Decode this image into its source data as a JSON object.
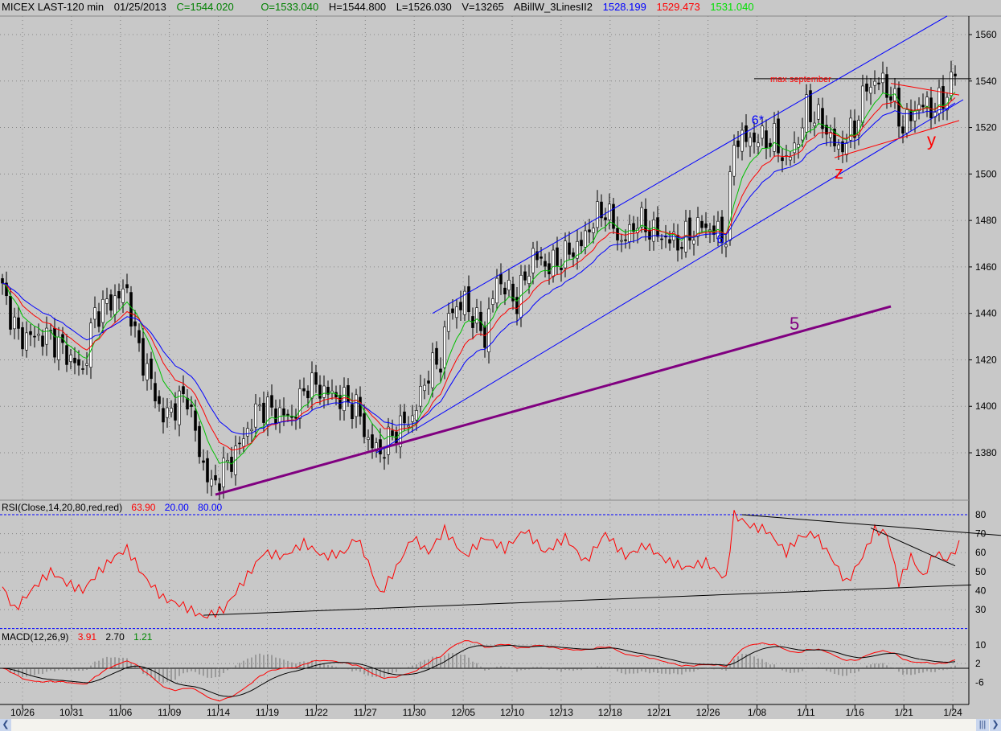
{
  "header": {
    "symbol": "MICEX LAST-120 min",
    "date": "01/25/2013",
    "close": "C=1544.020",
    "open": "O=1533.040",
    "high": "H=1544.800",
    "low": "L=1526.030",
    "volume": "V=13265",
    "indicator": "ABillW_3LinesII2",
    "ma1": "1528.199",
    "ma2": "1529.473",
    "ma3": "1531.040"
  },
  "rsi_label": {
    "name": "RSI(Close,14,20,80,red,red)",
    "value": "63.90",
    "low": "20.00",
    "high": "80.00"
  },
  "macd_label": {
    "name": "MACD(12,26,9)",
    "macd": "3.91",
    "signal": "2.70",
    "hist": "1.21"
  },
  "colors": {
    "blue": "#0000ff",
    "red": "#ff0000",
    "green": "#00c000",
    "purple": "#800080"
  },
  "chart_data": {
    "type": "candlestick",
    "price_axis": {
      "ticks": [
        "1560",
        "1540",
        "1520",
        "1500",
        "1480",
        "1460",
        "1440",
        "1420",
        "1400",
        "1380"
      ],
      "range": [
        1352,
        1568
      ]
    },
    "rsi_axis": {
      "ticks": [
        "80",
        "70",
        "60",
        "50",
        "40",
        "30"
      ],
      "range": [
        18,
        83
      ],
      "levels": [
        20,
        80
      ]
    },
    "macd_axis": {
      "ticks": [
        "10",
        "2",
        "-6"
      ],
      "range": [
        -11,
        13
      ]
    },
    "x_ticks": [
      "10/26",
      "10/31",
      "11/06",
      "11/09",
      "11/14",
      "11/19",
      "11/22",
      "11/27",
      "11/30",
      "12/05",
      "12/10",
      "12/13",
      "12/18",
      "12/21",
      "12/26",
      "1/08",
      "1/11",
      "1/16",
      "1/21",
      "1/24"
    ],
    "close_anchors": [
      [
        0,
        1450
      ],
      [
        4,
        1430
      ],
      [
        12,
        1430
      ],
      [
        20,
        1415
      ],
      [
        23,
        1440
      ],
      [
        31,
        1450
      ],
      [
        33,
        1430
      ],
      [
        36,
        1415
      ],
      [
        40,
        1395
      ],
      [
        46,
        1405
      ],
      [
        49,
        1380
      ],
      [
        52,
        1365
      ],
      [
        58,
        1380
      ],
      [
        64,
        1400
      ],
      [
        72,
        1395
      ],
      [
        76,
        1410
      ],
      [
        82,
        1405
      ],
      [
        88,
        1400
      ],
      [
        91,
        1385
      ],
      [
        94,
        1380
      ],
      [
        98,
        1390
      ],
      [
        102,
        1395
      ],
      [
        106,
        1415
      ],
      [
        109,
        1420
      ],
      [
        111,
        1440
      ],
      [
        115,
        1445
      ],
      [
        120,
        1430
      ],
      [
        123,
        1455
      ],
      [
        128,
        1445
      ],
      [
        132,
        1465
      ],
      [
        136,
        1460
      ],
      [
        140,
        1465
      ],
      [
        144,
        1470
      ],
      [
        147,
        1480
      ],
      [
        150,
        1485
      ],
      [
        154,
        1470
      ],
      [
        158,
        1480
      ],
      [
        162,
        1475
      ],
      [
        168,
        1470
      ],
      [
        174,
        1478
      ],
      [
        180,
        1473
      ],
      [
        182,
        1515
      ],
      [
        187,
        1515
      ],
      [
        192,
        1515
      ],
      [
        195,
        1505
      ],
      [
        198,
        1515
      ],
      [
        200,
        1528
      ],
      [
        204,
        1522
      ],
      [
        208,
        1510
      ],
      [
        212,
        1520
      ],
      [
        215,
        1538
      ],
      [
        219,
        1540
      ],
      [
        222,
        1530
      ],
      [
        224,
        1520
      ],
      [
        228,
        1530
      ],
      [
        232,
        1528
      ],
      [
        235,
        1535
      ],
      [
        237,
        1544
      ]
    ],
    "rsi_anchors": [
      [
        0,
        42
      ],
      [
        3,
        30
      ],
      [
        8,
        42
      ],
      [
        12,
        50
      ],
      [
        16,
        44
      ],
      [
        20,
        40
      ],
      [
        24,
        50
      ],
      [
        28,
        58
      ],
      [
        31,
        62
      ],
      [
        35,
        48
      ],
      [
        40,
        36
      ],
      [
        45,
        32
      ],
      [
        50,
        26
      ],
      [
        55,
        30
      ],
      [
        60,
        45
      ],
      [
        65,
        60
      ],
      [
        70,
        58
      ],
      [
        75,
        65
      ],
      [
        80,
        58
      ],
      [
        85,
        60
      ],
      [
        88,
        68
      ],
      [
        90,
        60
      ],
      [
        94,
        38
      ],
      [
        98,
        52
      ],
      [
        102,
        68
      ],
      [
        106,
        60
      ],
      [
        110,
        72
      ],
      [
        115,
        58
      ],
      [
        120,
        68
      ],
      [
        125,
        62
      ],
      [
        130,
        72
      ],
      [
        135,
        60
      ],
      [
        140,
        68
      ],
      [
        145,
        55
      ],
      [
        150,
        70
      ],
      [
        155,
        58
      ],
      [
        160,
        64
      ],
      [
        165,
        56
      ],
      [
        170,
        52
      ],
      [
        175,
        55
      ],
      [
        180,
        46
      ],
      [
        182,
        80
      ],
      [
        186,
        74
      ],
      [
        190,
        72
      ],
      [
        195,
        60
      ],
      [
        198,
        68
      ],
      [
        202,
        70
      ],
      [
        206,
        58
      ],
      [
        210,
        44
      ],
      [
        214,
        58
      ],
      [
        217,
        72
      ],
      [
        220,
        70
      ],
      [
        223,
        44
      ],
      [
        226,
        58
      ],
      [
        229,
        47
      ],
      [
        232,
        60
      ],
      [
        235,
        56
      ],
      [
        238,
        64
      ]
    ],
    "ma_periods": [
      8,
      14,
      22
    ],
    "annotations": [
      {
        "text": "max september",
        "type": "hline",
        "from": [
          187,
          1541
        ],
        "to": [
          241,
          1541
        ],
        "color": "#ff0000"
      },
      {
        "text": "5",
        "from": [
          53,
          1362
        ],
        "to": [
          221,
          1443
        ],
        "color": "#800080"
      },
      {
        "text": "6",
        "from": [
          93,
          1380
        ],
        "to": [
          239,
          1532
        ],
        "color": "#0000ff"
      },
      {
        "text": "6*",
        "from": [
          107,
          1440
        ],
        "to": [
          235,
          1568
        ],
        "color": "#0000ff"
      },
      {
        "text": "z",
        "at": [
          207,
          1498
        ],
        "color": "#ff0000"
      },
      {
        "text": "y",
        "at": [
          230,
          1512
        ],
        "color": "#ff0000"
      }
    ],
    "extra_lines": [
      {
        "from": [
          221,
          1539
        ],
        "to": [
          238,
          1534
        ],
        "color": "#ff0000"
      },
      {
        "from": [
          207,
          1507
        ],
        "to": [
          238,
          1523
        ],
        "color": "#ff0000"
      }
    ],
    "rsi_trendlines": [
      [
        [
          50,
          27
        ],
        [
          241,
          43
        ]
      ],
      [
        [
          184,
          80
        ],
        [
          249,
          69
        ]
      ],
      [
        [
          216,
          73
        ],
        [
          237,
          53
        ]
      ]
    ]
  }
}
